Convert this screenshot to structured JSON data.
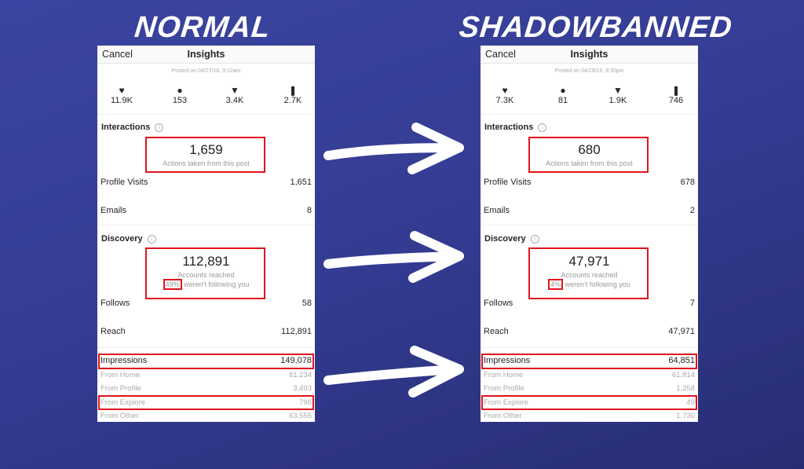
{
  "titles": {
    "left": "NORMAL",
    "right": "SHADOWBANNED"
  },
  "colors": {
    "highlight": "#e0141c",
    "background": "#343c92"
  },
  "panels": [
    {
      "cancel": "Cancel",
      "title": "Insights",
      "posted": "Posted on 04/27/18, 9:12am",
      "stats": [
        {
          "icon": "heart-icon",
          "value": "11.9K"
        },
        {
          "icon": "comment-icon",
          "value": "153"
        },
        {
          "icon": "share-icon",
          "value": "3.4K"
        },
        {
          "icon": "bookmark-icon",
          "value": "2.7K"
        }
      ],
      "interactions": {
        "label": "Interactions",
        "value": "1,659",
        "caption": "Actions taken from this post",
        "rows": [
          {
            "label": "Profile Visits",
            "value": "1,651"
          },
          {
            "label": "Emails",
            "value": "8"
          }
        ]
      },
      "discovery": {
        "label": "Discovery",
        "value": "112,891",
        "caption": "Accounts reached",
        "percent": "49%",
        "percent_caption": "weren't following you",
        "rows": [
          {
            "label": "Follows",
            "value": "58"
          },
          {
            "label": "Reach",
            "value": "112,891"
          }
        ]
      },
      "impressions": {
        "label": "Impressions",
        "value": "149,078",
        "rows": [
          {
            "label": "From Home",
            "value": "81,234"
          },
          {
            "label": "From Profile",
            "value": "3,493"
          },
          {
            "label": "From Explore",
            "value": "796"
          },
          {
            "label": "From Other",
            "value": "63,555"
          }
        ]
      }
    },
    {
      "cancel": "Cancel",
      "title": "Insights",
      "posted": "Posted on 04/29/19, 9:35pm",
      "stats": [
        {
          "icon": "heart-icon",
          "value": "7.3K"
        },
        {
          "icon": "comment-icon",
          "value": "81"
        },
        {
          "icon": "share-icon",
          "value": "1.9K"
        },
        {
          "icon": "bookmark-icon",
          "value": "746"
        }
      ],
      "interactions": {
        "label": "Interactions",
        "value": "680",
        "caption": "Actions taken from this post",
        "rows": [
          {
            "label": "Profile Visits",
            "value": "678"
          },
          {
            "label": "Emails",
            "value": "2"
          }
        ]
      },
      "discovery": {
        "label": "Discovery",
        "value": "47,971",
        "caption": "Accounts reached",
        "percent": "4%",
        "percent_caption": "weren't following you",
        "rows": [
          {
            "label": "Follows",
            "value": "7"
          },
          {
            "label": "Reach",
            "value": "47,971"
          }
        ]
      },
      "impressions": {
        "label": "Impressions",
        "value": "64,851",
        "rows": [
          {
            "label": "From Home",
            "value": "61,814"
          },
          {
            "label": "From Profile",
            "value": "1,258"
          },
          {
            "label": "From Explore",
            "value": "49"
          },
          {
            "label": "From Other",
            "value": "1,730"
          }
        ]
      }
    }
  ]
}
